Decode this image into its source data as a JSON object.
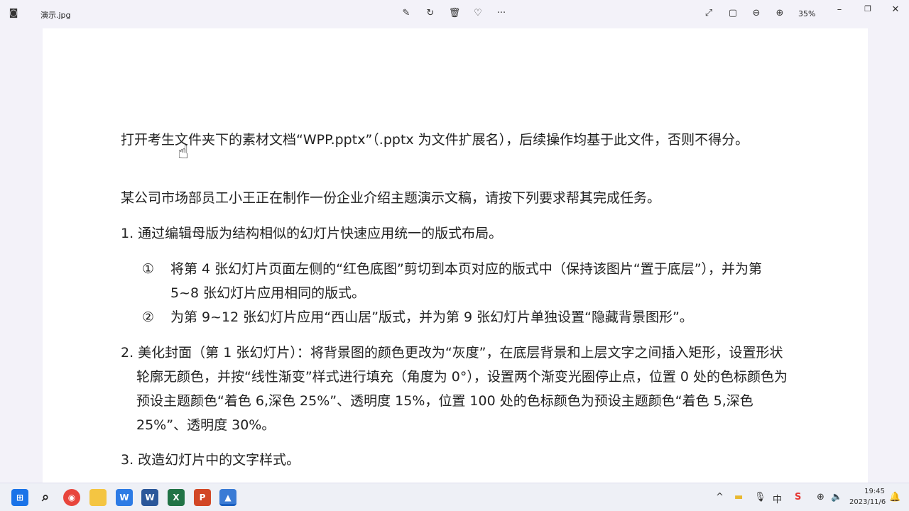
{
  "window": {
    "title": "演示.jpg",
    "zoom": "35%"
  },
  "toolbar": {
    "edit": "✎",
    "rotate": "↻",
    "delete": "🗑",
    "favorite": "♡",
    "more": "···",
    "fullscreen": "⤢",
    "fit": "▢",
    "zoom_out": "⊖",
    "zoom_in": "⊕",
    "minimize": "–",
    "restore": "❐",
    "close": "✕"
  },
  "content": {
    "p1": "打开考生文件夹下的素材文档“WPP.pptx”（.pptx 为文件扩展名），后续操作均基于此文件，否则不得分。",
    "p2": "某公司市场部员工小王正在制作一份企业介绍主题演示文稿，请按下列要求帮其完成任务。",
    "p3": "1. 通过编辑母版为结构相似的幻灯片快速应用统一的版式布局。",
    "p4_num": "①",
    "p4": "将第 4 张幻灯片页面左侧的“红色底图”剪切到本页对应的版式中（保持该图片“置于底层”），并为第 5~8 张幻灯片应用相同的版式。",
    "p5_num": "②",
    "p5": "为第 9~12 张幻灯片应用“西山居”版式，并为第 9 张幻灯片单独设置“隐藏背景图形”。",
    "p6": "2. 美化封面（第 1 张幻灯片）：将背景图的颜色更改为“灰度”，在底层背景和上层文字之间插入矩形，设置形状轮廓无颜色，并按“线性渐变”样式进行填充（角度为 0°），设置两个渐变光圈停止点，位置 0 处的色标颜色为预设主题颜色“着色 6,深色 25%”、透明度 15%，位置 100 处的色标颜色为预设主题颜色“着色 5,深色 25%”、透明度 30%。",
    "p7": "3. 改造幻灯片中的文字样式。"
  },
  "tray": {
    "time": "19:45",
    "date": "2023/11/6"
  }
}
